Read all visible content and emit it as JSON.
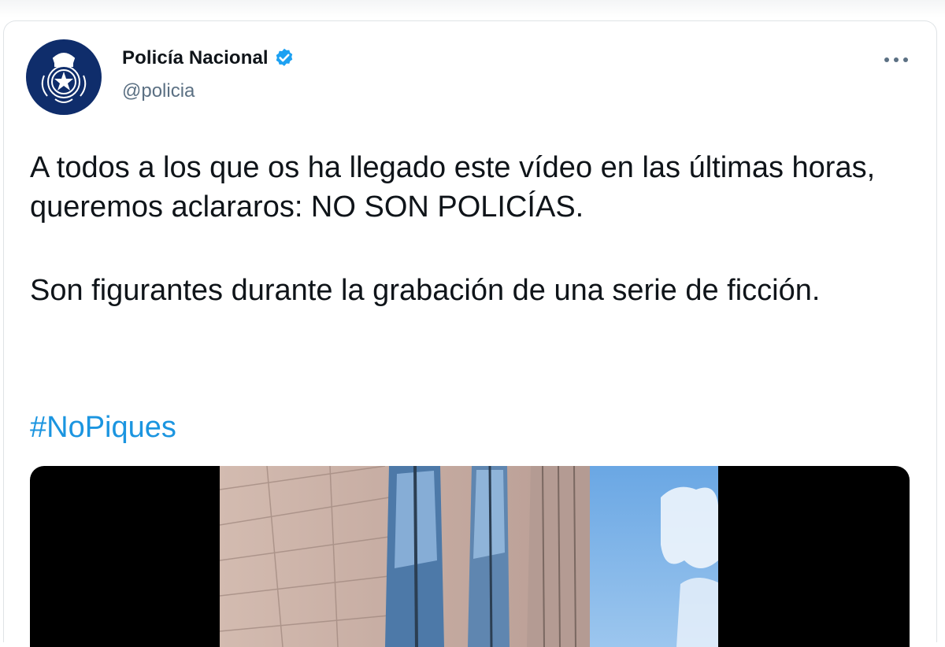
{
  "tweet": {
    "author": {
      "display_name": "Policía Nacional",
      "handle": "@policia",
      "verified": true,
      "avatar_icon": "police-badge-icon"
    },
    "more_icon": "more-icon",
    "text_paragraphs": [
      "A todos a los que os ha llegado este vídeo en las últimas horas, queremos aclararos: NO SON POLICÍAS.",
      "Son figurantes durante la grabación de una serie de ficción."
    ],
    "hashtag": "#NoPiques",
    "media": {
      "type": "video",
      "colors": {
        "sky": "#7fb4e6",
        "wall": "#c9b1a6",
        "glass": "#5f86b0"
      }
    }
  },
  "colors": {
    "accent": "#1b95e0",
    "verified": "#1da1f2",
    "avatar_bg": "#0f2d6b",
    "text": "#0f1419",
    "secondary_text": "#5b7083"
  }
}
